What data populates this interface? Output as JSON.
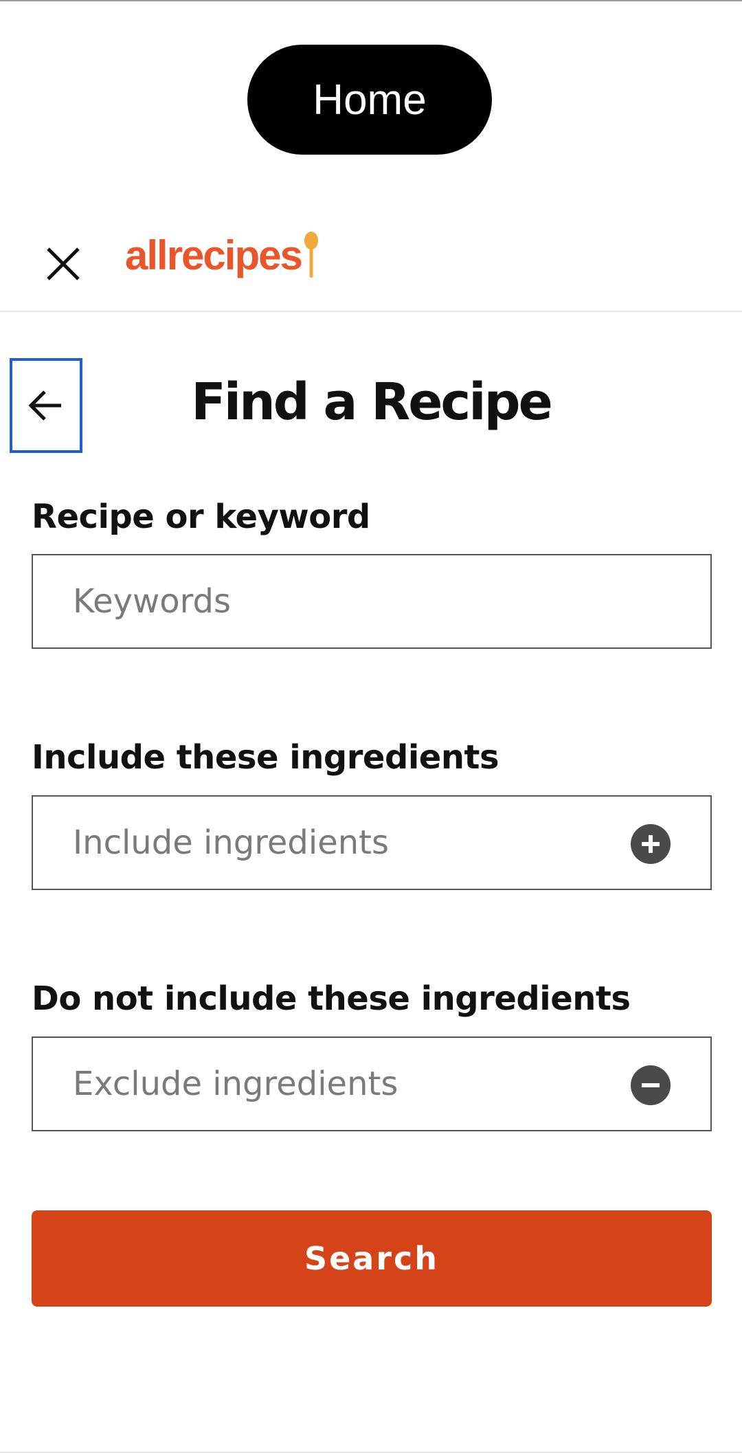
{
  "top_bar": {
    "home_label": "Home"
  },
  "header": {
    "logo_text": "allrecipes",
    "close_icon": "close-icon",
    "brand_color": "#e8562a",
    "spoon_color": "#f2a93b"
  },
  "page": {
    "title": "Find a Recipe",
    "back_icon": "arrow-left-icon"
  },
  "fields": {
    "keyword": {
      "label": "Recipe or keyword",
      "placeholder": "Keywords",
      "value": ""
    },
    "include": {
      "label": "Include these ingredients",
      "placeholder": "Include ingredients",
      "value": "",
      "action_icon": "plus-circle-icon"
    },
    "exclude": {
      "label": "Do not include these ingredients",
      "placeholder": "Exclude ingredients",
      "value": "",
      "action_icon": "minus-circle-icon"
    }
  },
  "actions": {
    "search_label": "Search",
    "search_color": "#d44418"
  }
}
